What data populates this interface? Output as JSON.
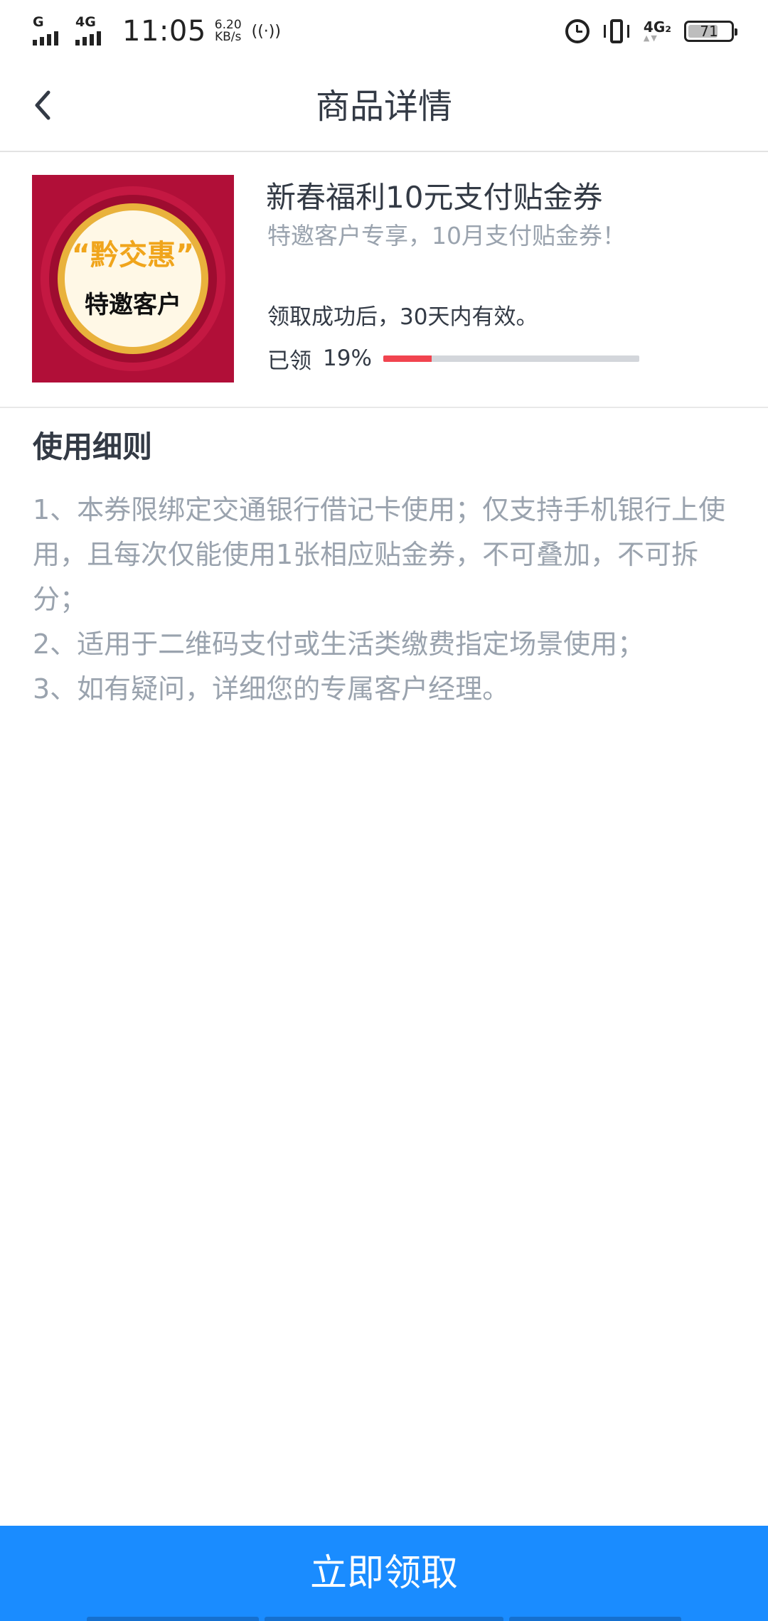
{
  "status_bar": {
    "network_left": "G",
    "network_second": "4G",
    "time": "11:05",
    "speed_value": "6.20",
    "speed_unit": "KB/s",
    "network_right": "4G₂",
    "battery_level": "71",
    "battery_fraction": 0.71
  },
  "header": {
    "title": "商品详情",
    "back_icon": "chevron-left-icon"
  },
  "product": {
    "image_tagline": "“黔交惠”",
    "image_badge": "特邀客户",
    "title": "新春福利10元支付贴金券",
    "subtitle": "特邀客户专享，10月支付贴金券！",
    "validity": "领取成功后，30天内有效。",
    "claimed_label": "已领",
    "claimed_percent": "19%",
    "claimed_fraction": 0.19,
    "progress_color": "#f1444f"
  },
  "rules": {
    "heading": "使用细则",
    "items": [
      "1、本券限绑定交通银行借记卡使用；仅支持手机银行上使用，且每次仅能使用1张相应贴金券，不可叠加，不可拆分；",
      "2、适用于二维码支付或生活类缴费指定场景使用；",
      "3、如有疑问，详细您的专属客户经理。"
    ]
  },
  "action": {
    "claim_label": "立即领取",
    "button_color": "#1a8cff"
  }
}
